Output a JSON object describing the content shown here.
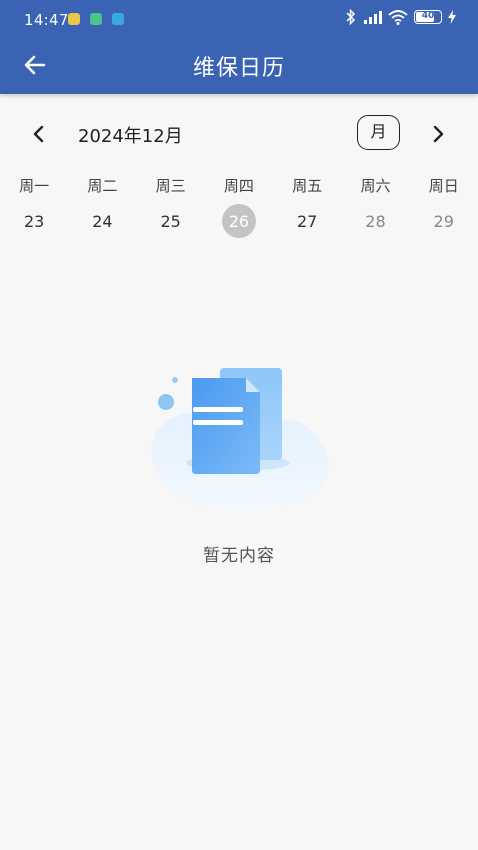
{
  "status_bar": {
    "time": "14:47",
    "battery_level": "40"
  },
  "app_bar": {
    "title": "维保日历",
    "back_icon": "arrow-left-icon"
  },
  "calendar": {
    "month_label": "2024年12月",
    "view_mode_label": "月",
    "weekdays": [
      "周一",
      "周二",
      "周三",
      "周四",
      "周五",
      "周六",
      "周日"
    ],
    "dates": [
      "23",
      "24",
      "25",
      "26",
      "27",
      "28",
      "29"
    ],
    "selected_date": "26"
  },
  "empty_state": {
    "text": "暂无内容",
    "icon": "empty-document-icon"
  },
  "colors": {
    "primary": "#3a63b3",
    "background": "#f7f7f8",
    "selected_date_bg": "#c4c4c4"
  }
}
